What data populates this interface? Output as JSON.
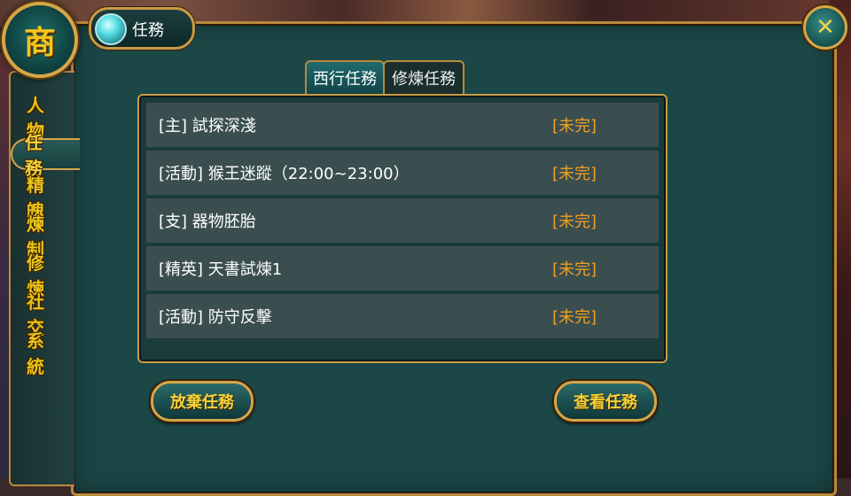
{
  "emblem": {
    "char": "商"
  },
  "title": "任務",
  "close_symbol": "✕",
  "left_menu": [
    {
      "label": "人物",
      "active": false
    },
    {
      "label": "任務",
      "active": true
    },
    {
      "label": "精魄",
      "active": false
    },
    {
      "label": "煉制",
      "active": false
    },
    {
      "label": "修煉",
      "active": false
    },
    {
      "label": "社交",
      "active": false
    },
    {
      "label": "系統",
      "active": false
    }
  ],
  "tabs": [
    {
      "label": "西行任務",
      "active": true
    },
    {
      "label": "修煉任務",
      "active": false
    }
  ],
  "tasks": [
    {
      "name": "[主] 試探深淺",
      "status": "[未完]"
    },
    {
      "name": "[活動] 猴王迷蹤（22:00~23:00）",
      "status": "[未完]"
    },
    {
      "name": "[支] 器物胚胎",
      "status": "[未完]"
    },
    {
      "name": "[精英] 天書試煉1",
      "status": "[未完]"
    },
    {
      "name": "[活動] 防守反擊",
      "status": "[未完]"
    }
  ],
  "buttons": {
    "abandon": "放棄任務",
    "view": "查看任務"
  },
  "colors": {
    "panel_bg": "#1b4747",
    "gold_border": "#c99a45",
    "menu_text": "#e8c21a",
    "status_text": "#f0a020"
  }
}
